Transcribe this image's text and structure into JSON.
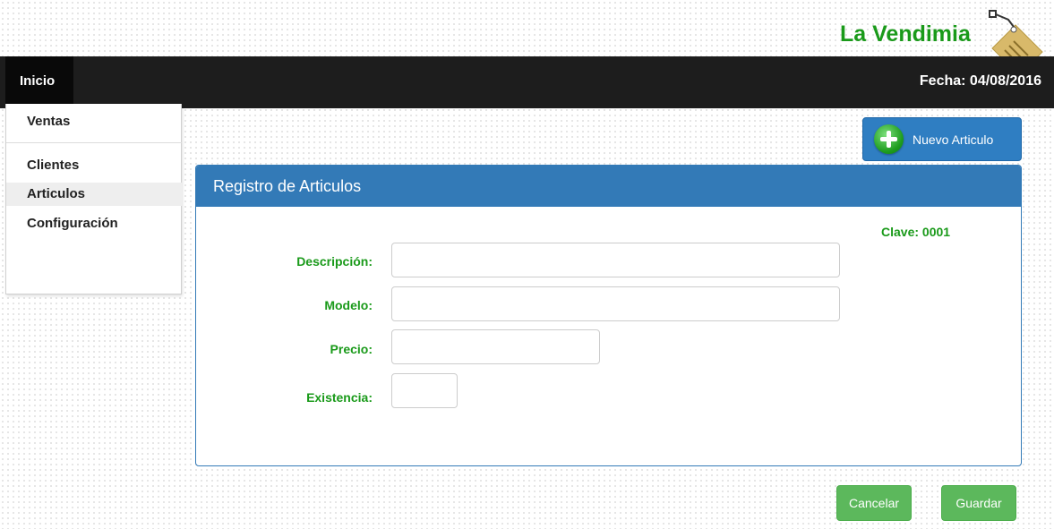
{
  "header": {
    "brand": "La Vendimia",
    "logo_icon": "wine-tag-icon",
    "brand_color": "#1a9a1a"
  },
  "navbar": {
    "home_tab": "Inicio",
    "date": "Fecha: 04/08/2016"
  },
  "menu": {
    "items": [
      {
        "label": "Ventas"
      },
      {
        "label": "Clientes"
      },
      {
        "label": "Articulos",
        "active": true
      },
      {
        "label": "Configuración"
      }
    ]
  },
  "toolbar": {
    "new_button": "Nuevo Articulo",
    "new_icon": "plus-circle-icon"
  },
  "form": {
    "title": "Registro de Articulos",
    "clave": "Clave: 0001",
    "fields": {
      "descripcion": {
        "label": "Descripción:",
        "value": ""
      },
      "modelo": {
        "label": "Modelo:",
        "value": ""
      },
      "precio": {
        "label": "Precio:",
        "value": ""
      },
      "existencia": {
        "label": "Existencia:",
        "value": ""
      }
    }
  },
  "actions": {
    "cancel": "Cancelar",
    "save": "Guardar"
  },
  "colors": {
    "navbar": "#1d1d1d",
    "panel_primary": "#337ab7",
    "success": "#5cb85c",
    "label_green": "#1a9a1a"
  }
}
